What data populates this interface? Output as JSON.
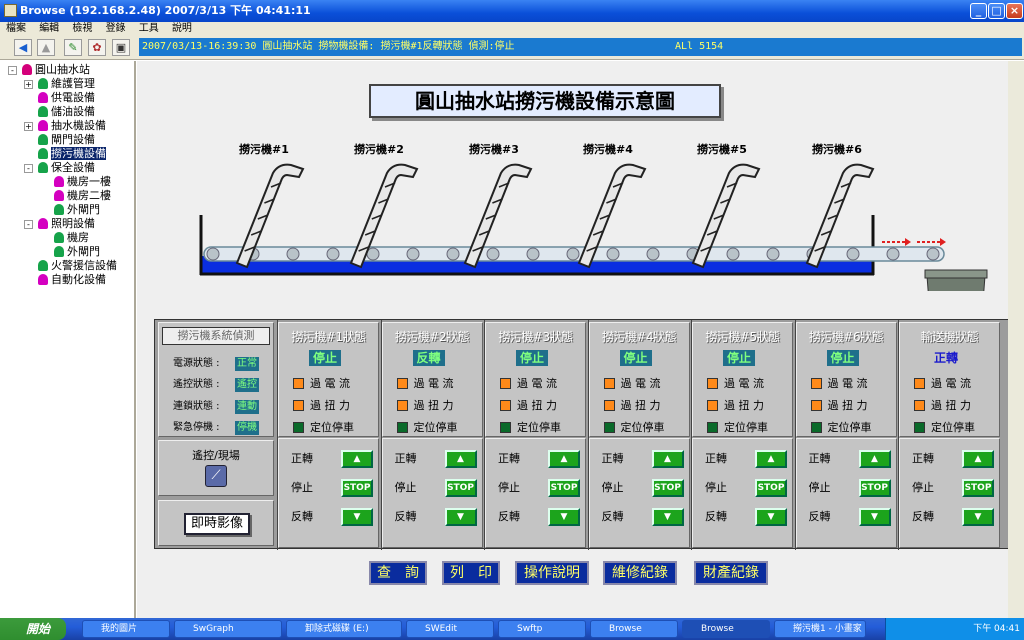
{
  "window": {
    "title": "Browse (192.168.2.48)    2007/3/13 下午 04:41:11"
  },
  "menu": [
    "檔案",
    "編輯",
    "檢視",
    "登錄",
    "工具",
    "說明"
  ],
  "status": {
    "text": "2007/03/13-16:39:30  圓山抽水站  撈物機設備: 撈污機#1反轉狀態    偵測:停止",
    "alarm": "ALl 5154"
  },
  "tree": [
    {
      "label": "圓山抽水站",
      "level": 0,
      "color": "#d4007a",
      "expand": "-"
    },
    {
      "label": "維護管理",
      "level": 1,
      "color": "#16a34a",
      "expand": "+"
    },
    {
      "label": "供電設備",
      "level": 1,
      "color": "#d400c0"
    },
    {
      "label": "儲油設備",
      "level": 1,
      "color": "#16a34a"
    },
    {
      "label": "抽水機設備",
      "level": 1,
      "color": "#d400c0",
      "expand": "+"
    },
    {
      "label": "閘門設備",
      "level": 1,
      "color": "#16a34a"
    },
    {
      "label": "撈污機設備",
      "level": 1,
      "color": "#16a34a",
      "selected": true
    },
    {
      "label": "保全設備",
      "level": 1,
      "color": "#16a34a",
      "expand": "-"
    },
    {
      "label": "機房一樓",
      "level": 2,
      "color": "#d400c0"
    },
    {
      "label": "機房二樓",
      "level": 2,
      "color": "#d400c0"
    },
    {
      "label": "外閘門",
      "level": 2,
      "color": "#16a34a"
    },
    {
      "label": "照明設備",
      "level": 1,
      "color": "#d400c0",
      "expand": "-"
    },
    {
      "label": "機房",
      "level": 2,
      "color": "#16a34a"
    },
    {
      "label": "外閘門",
      "level": 2,
      "color": "#16a34a"
    },
    {
      "label": "火警援信設備",
      "level": 1,
      "color": "#16a34a"
    },
    {
      "label": "自動化設備",
      "level": 1,
      "color": "#d400c0"
    }
  ],
  "diagram": {
    "title": "圓山抽水站撈污機設備示意圖",
    "machines": [
      "撈污機#1",
      "撈污機#2",
      "撈污機#3",
      "撈污機#4",
      "撈污機#5",
      "撈污機#6"
    ]
  },
  "detection": {
    "title": "撈污機系統偵測",
    "rows": [
      {
        "label": "電源狀態 :",
        "value": "正常"
      },
      {
        "label": "遙控狀態 :",
        "value": "遙控"
      },
      {
        "label": "連鎖狀態 :",
        "value": "連動"
      },
      {
        "label": "緊急停機 :",
        "value": "停機"
      }
    ],
    "remote_label": "遙控/現場",
    "live_button": "即時影像"
  },
  "columns": [
    {
      "title": "撈污機#1狀態",
      "state": "停止",
      "blue": false
    },
    {
      "title": "撈污機#2狀態",
      "state": "反轉",
      "blue": false
    },
    {
      "title": "撈污機#3狀態",
      "state": "停止",
      "blue": false
    },
    {
      "title": "撈污機#4狀態",
      "state": "停止",
      "blue": false
    },
    {
      "title": "撈污機#5狀態",
      "state": "停止",
      "blue": false
    },
    {
      "title": "撈污機#6狀態",
      "state": "停止",
      "blue": false
    },
    {
      "title": "輸送機狀態",
      "state": "正轉",
      "blue": true
    }
  ],
  "status_lamps": [
    {
      "label": "過 電 流",
      "color": "#ff8a1a"
    },
    {
      "label": "過 扭 力",
      "color": "#ff8a1a"
    },
    {
      "label": "定位停車",
      "color": "#0a6a2a"
    }
  ],
  "controls": [
    {
      "label": "正轉",
      "symbol": "▲"
    },
    {
      "label": "停止",
      "symbol": "STOP"
    },
    {
      "label": "反轉",
      "symbol": "▼"
    }
  ],
  "nav": [
    "查　詢",
    "列　印",
    "操作說明",
    "維修紀錄",
    "財產紀錄"
  ],
  "taskbar": {
    "start": "開始",
    "items": [
      "我的圖片",
      "SwGraph",
      "卸除式磁碟 (E:)",
      "SWEdit",
      "Swftp",
      "Browse",
      "Browse",
      "撈污機1 - 小畫家"
    ],
    "clock": "下午 04:41"
  },
  "colors": {
    "water": "#0a2ee0",
    "status_bg": "#1a7ad0",
    "panel_bg": "#c4c4c4"
  }
}
